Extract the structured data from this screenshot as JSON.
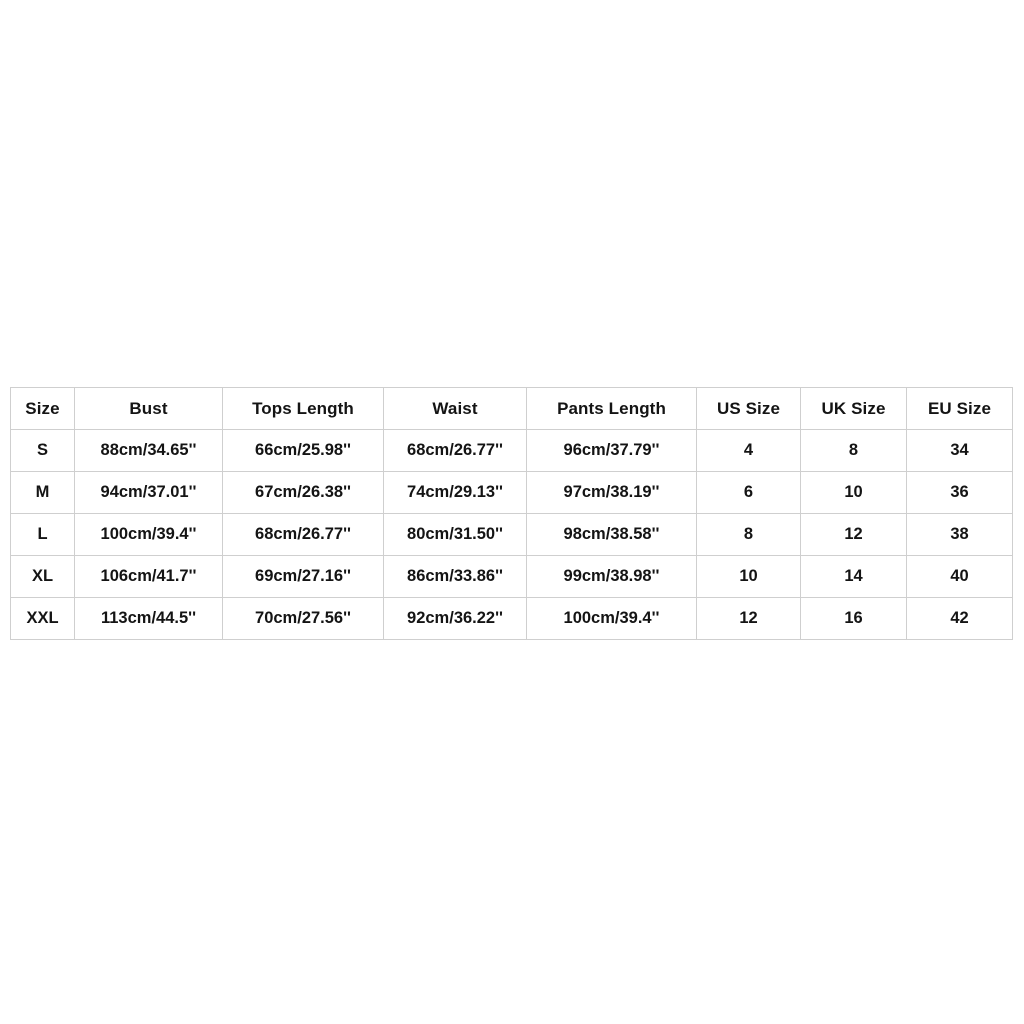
{
  "chart_data": {
    "type": "table",
    "title": "",
    "columns": [
      "Size",
      "Bust",
      "Tops Length",
      "Waist",
      "Pants Length",
      "US Size",
      "UK Size",
      "EU Size"
    ],
    "rows": [
      [
        "S",
        "88cm/34.65''",
        "66cm/25.98''",
        "68cm/26.77''",
        "96cm/37.79''",
        "4",
        "8",
        "34"
      ],
      [
        "M",
        "94cm/37.01''",
        "67cm/26.38''",
        "74cm/29.13''",
        "97cm/38.19''",
        "6",
        "10",
        "36"
      ],
      [
        "L",
        "100cm/39.4''",
        "68cm/26.77''",
        "80cm/31.50''",
        "98cm/38.58''",
        "8",
        "12",
        "38"
      ],
      [
        "XL",
        "106cm/41.7''",
        "69cm/27.16''",
        "86cm/33.86''",
        "99cm/38.98''",
        "10",
        "14",
        "40"
      ],
      [
        "XXL",
        "113cm/44.5''",
        "70cm/27.56''",
        "92cm/36.22''",
        "100cm/39.4''",
        "12",
        "16",
        "42"
      ]
    ],
    "border_color": "#cfcfcf",
    "text_color": "#141414",
    "background": "#ffffff"
  },
  "table": {
    "headers": {
      "size": "Size",
      "bust": "Bust",
      "tops_length": "Tops Length",
      "waist": "Waist",
      "pants_length": "Pants Length",
      "us_size": "US Size",
      "uk_size": "UK Size",
      "eu_size": "EU Size"
    },
    "rows": [
      {
        "size": "S",
        "bust": "88cm/34.65''",
        "tops_length": "66cm/25.98''",
        "waist": "68cm/26.77''",
        "pants_length": "96cm/37.79''",
        "us_size": "4",
        "uk_size": "8",
        "eu_size": "34"
      },
      {
        "size": "M",
        "bust": "94cm/37.01''",
        "tops_length": "67cm/26.38''",
        "waist": "74cm/29.13''",
        "pants_length": "97cm/38.19''",
        "us_size": "6",
        "uk_size": "10",
        "eu_size": "36"
      },
      {
        "size": "L",
        "bust": "100cm/39.4''",
        "tops_length": "68cm/26.77''",
        "waist": "80cm/31.50''",
        "pants_length": "98cm/38.58''",
        "us_size": "8",
        "uk_size": "12",
        "eu_size": "38"
      },
      {
        "size": "XL",
        "bust": "106cm/41.7''",
        "tops_length": "69cm/27.16''",
        "waist": "86cm/33.86''",
        "pants_length": "99cm/38.98''",
        "us_size": "10",
        "uk_size": "14",
        "eu_size": "40"
      },
      {
        "size": "XXL",
        "bust": "113cm/44.5''",
        "tops_length": "70cm/27.56''",
        "waist": "92cm/36.22''",
        "pants_length": "100cm/39.4''",
        "us_size": "12",
        "uk_size": "16",
        "eu_size": "42"
      }
    ]
  }
}
